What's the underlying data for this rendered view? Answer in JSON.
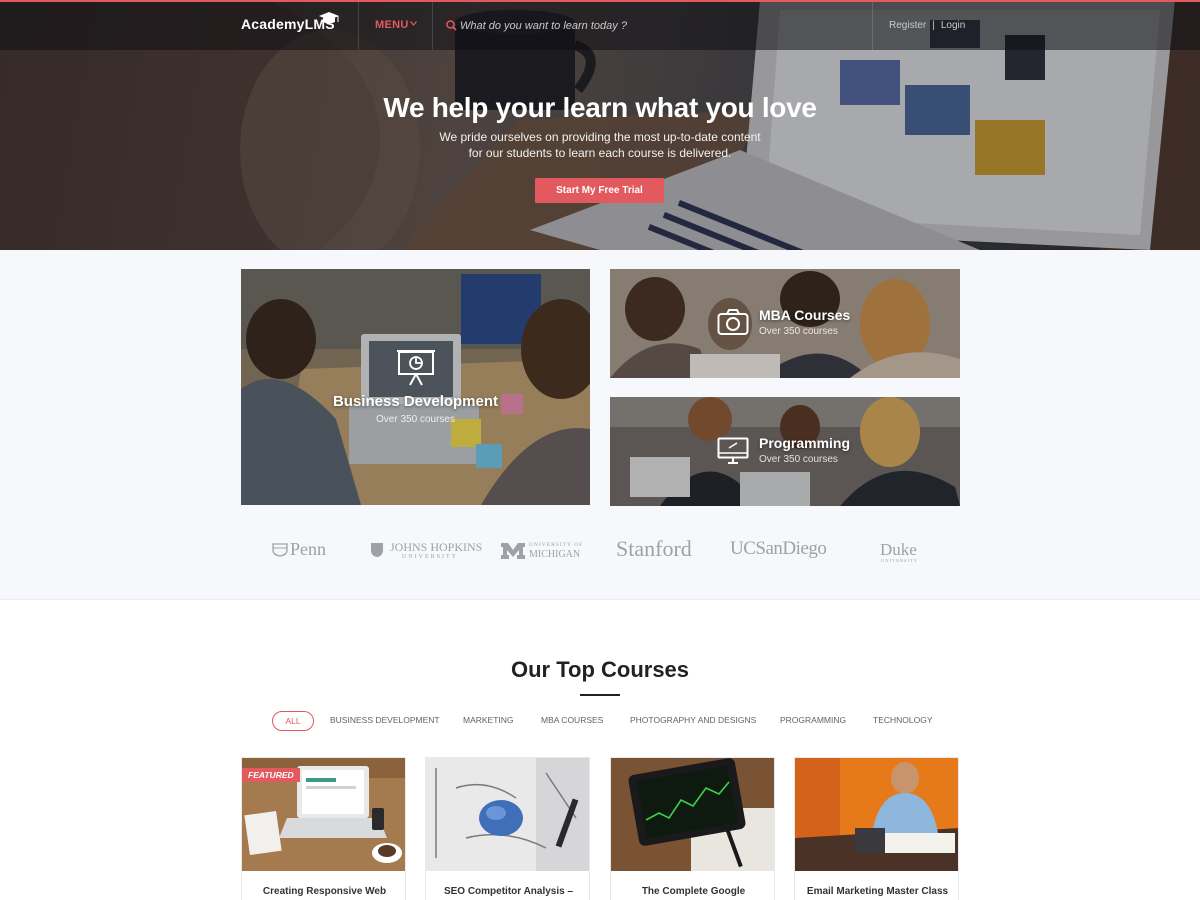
{
  "brand": {
    "name": "AcademyLMS",
    "accent": "#e25a5e"
  },
  "nav": {
    "menu_label": "MENU",
    "search_placeholder": "What do you want to learn today ?",
    "register": "Register",
    "separator": "|",
    "login": "Login"
  },
  "hero": {
    "title": "We help your learn what you love",
    "subtitle_line1": "We pride ourselves on providing the most up-to-date content",
    "subtitle_line2": "for our students to learn each course is delivered.",
    "cta": "Start My Free Trial"
  },
  "categories": [
    {
      "name": "Business Development",
      "count": "Over 350 courses",
      "icon": "presentation-board-icon"
    },
    {
      "name": "MBA Courses",
      "count": "Over 350 courses",
      "icon": "camera-icon"
    },
    {
      "name": "Programming",
      "count": "Over 350 courses",
      "icon": "monitor-icon"
    }
  ],
  "partners": [
    "Penn",
    "JOHNS HOPKINS",
    "UNIVERSITY",
    "UNIVERSITY OF",
    "MICHIGAN",
    "Stanford",
    "UCSanDiego",
    "Duke",
    "UNIVERSITY"
  ],
  "courses_section": {
    "title": "Our Top Courses",
    "filters": [
      "ALL",
      "BUSINESS DEVELOPMENT",
      "MARKETING",
      "MBA COURSES",
      "PHOTOGRAPHY AND DESIGNS",
      "PROGRAMMING",
      "TECHNOLOGY"
    ],
    "courses": [
      {
        "title": "Creating Responsive Web",
        "badge": "FEATURED"
      },
      {
        "title": "SEO Competitor Analysis –",
        "badge": ""
      },
      {
        "title": "The Complete Google",
        "badge": ""
      },
      {
        "title": "Email Marketing Master Class",
        "badge": ""
      }
    ]
  }
}
